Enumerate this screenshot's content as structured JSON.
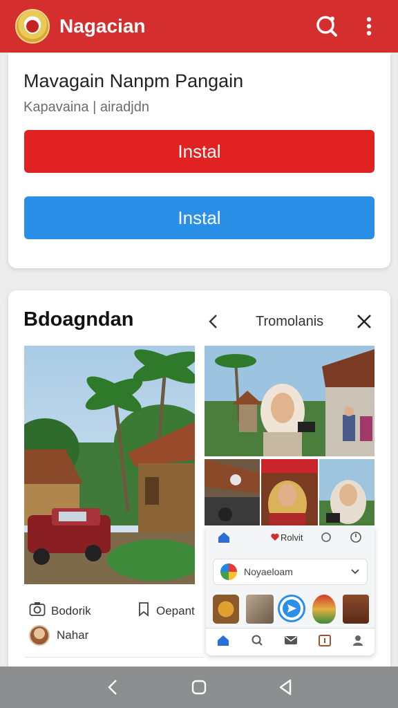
{
  "app": {
    "title": "Nagacian",
    "brand_color": "#d42e2e"
  },
  "card1": {
    "title": "Mavagain Nanpm Pangain",
    "subtitle": "Kapavaina | airadjdn",
    "primary_button": "Instal",
    "secondary_button": "Instal",
    "primary_color": "#e12222",
    "secondary_color": "#2a8fe6"
  },
  "card2": {
    "title": "Bdoagndan",
    "tab_label": "Tromolanis",
    "actions": {
      "left_label": "Bodorik",
      "left_icon": "camera-icon",
      "right_label": "Oepant",
      "right_icon": "bookmark-icon"
    },
    "user_name": "Nahar"
  },
  "popup": {
    "top_label": "Rolvit",
    "select_value": "Noyaeloam",
    "nav_icons": [
      "home-icon",
      "search-icon",
      "mail-icon",
      "calendar-icon",
      "profile-icon"
    ]
  },
  "system_nav": [
    "back-icon",
    "home-icon",
    "recents-icon"
  ]
}
